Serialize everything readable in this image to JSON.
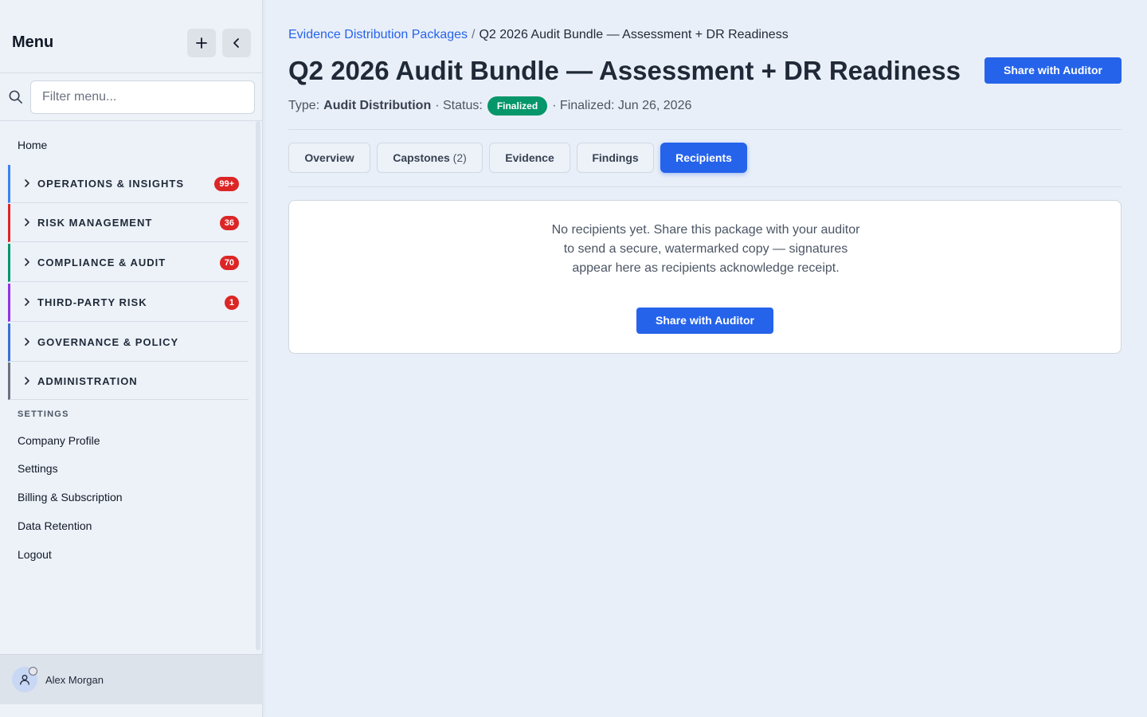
{
  "sidebar": {
    "title": "Menu",
    "add_icon": "plus-icon",
    "collapse_icon": "chevron-left-icon",
    "search": {
      "placeholder": "Filter menu...",
      "icon": "search-icon"
    },
    "home_label": "Home",
    "groups": [
      {
        "label": "OPERATIONS & INSIGHTS",
        "badge": "99+",
        "accent": "#3b82f6"
      },
      {
        "label": "RISK MANAGEMENT",
        "badge": "36",
        "accent": "#dc2626"
      },
      {
        "label": "COMPLIANCE & AUDIT",
        "badge": "70",
        "accent": "#059669"
      },
      {
        "label": "THIRD-PARTY RISK",
        "badge": "1",
        "accent": "#9333ea"
      },
      {
        "label": "GOVERNANCE & POLICY",
        "badge": "",
        "accent": "#3b6fd6"
      },
      {
        "label": "ADMINISTRATION",
        "badge": "",
        "accent": "#6b7280"
      }
    ],
    "settings_heading": "SETTINGS",
    "settings_links": [
      "Company Profile",
      "Settings",
      "Billing & Subscription",
      "Data Retention",
      "Logout"
    ],
    "user": {
      "name": "Alex Morgan",
      "avatar_icon": "user-icon"
    }
  },
  "breadcrumb": {
    "parent": "Evidence Distribution Packages",
    "separator": "/",
    "current": "Q2 2026 Audit Bundle — Assessment + DR Readiness"
  },
  "header": {
    "title": "Q2 2026 Audit Bundle — Assessment + DR Readiness",
    "share_label": "Share with Auditor",
    "type_label": "Type:",
    "type_value": "Audit Distribution",
    "status_label": "· Status:",
    "status_value": "Finalized",
    "finalized_text": "· Finalized: Jun 26, 2026"
  },
  "tabs": [
    {
      "label": "Overview",
      "count": ""
    },
    {
      "label": "Capstones",
      "count": "(2)"
    },
    {
      "label": "Evidence",
      "count": ""
    },
    {
      "label": "Findings",
      "count": ""
    },
    {
      "label": "Recipients",
      "count": "",
      "active": true
    }
  ],
  "recipients": {
    "empty_message": "No recipients yet. Share this package with your auditor to send a secure, watermarked copy — signatures appear here as recipients acknowledge receipt.",
    "share_label": "Share with Auditor"
  },
  "colors": {
    "accent": "#2563eb",
    "status_finalized": "#059669",
    "badge": "#dc2626"
  }
}
